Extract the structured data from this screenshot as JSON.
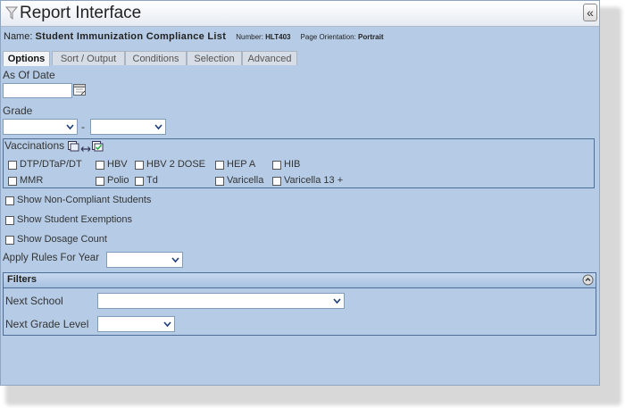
{
  "window": {
    "title": "Report Interface",
    "collapse_glyph": "«"
  },
  "report": {
    "name_label": "Name:",
    "name_value": "Student Immunization Compliance List",
    "number_label": "Number:",
    "number_value": "HLT403",
    "orientation_label": "Page Orientation:",
    "orientation_value": "Portrait"
  },
  "tabs": [
    {
      "label": "Options",
      "active": true
    },
    {
      "label": "Sort / Output"
    },
    {
      "label": "Conditions"
    },
    {
      "label": "Selection"
    },
    {
      "label": "Advanced"
    }
  ],
  "options": {
    "as_of_date_label": "As Of Date",
    "as_of_date_value": "",
    "grade_label": "Grade",
    "grade_separator": "-",
    "grade_from": "",
    "grade_to": "",
    "vaccinations_label": "Vaccinations",
    "vaccinations": [
      {
        "label": "DTP/DTaP/DT",
        "checked": false
      },
      {
        "label": "HBV",
        "checked": false
      },
      {
        "label": "HBV 2 DOSE",
        "checked": false
      },
      {
        "label": "HEP A",
        "checked": false
      },
      {
        "label": "HIB",
        "checked": false
      },
      {
        "label": "MMR",
        "checked": false
      },
      {
        "label": "Polio",
        "checked": false
      },
      {
        "label": "Td",
        "checked": false
      },
      {
        "label": "Varicella",
        "checked": false
      },
      {
        "label": "Varicella 13 +",
        "checked": false
      }
    ],
    "show_non_compliant": "Show Non-Compliant Students",
    "show_exemptions": "Show Student Exemptions",
    "show_dosage_count": "Show Dosage Count",
    "apply_rules_label": "Apply Rules For Year",
    "apply_rules_value": ""
  },
  "filters": {
    "title": "Filters",
    "next_school_label": "Next School",
    "next_school_value": "",
    "next_grade_label": "Next Grade Level",
    "next_grade_value": ""
  },
  "colors": {
    "panel_bg": "#b6cce6",
    "border": "#4c6e98",
    "filter_head": "#a9c2e2"
  }
}
